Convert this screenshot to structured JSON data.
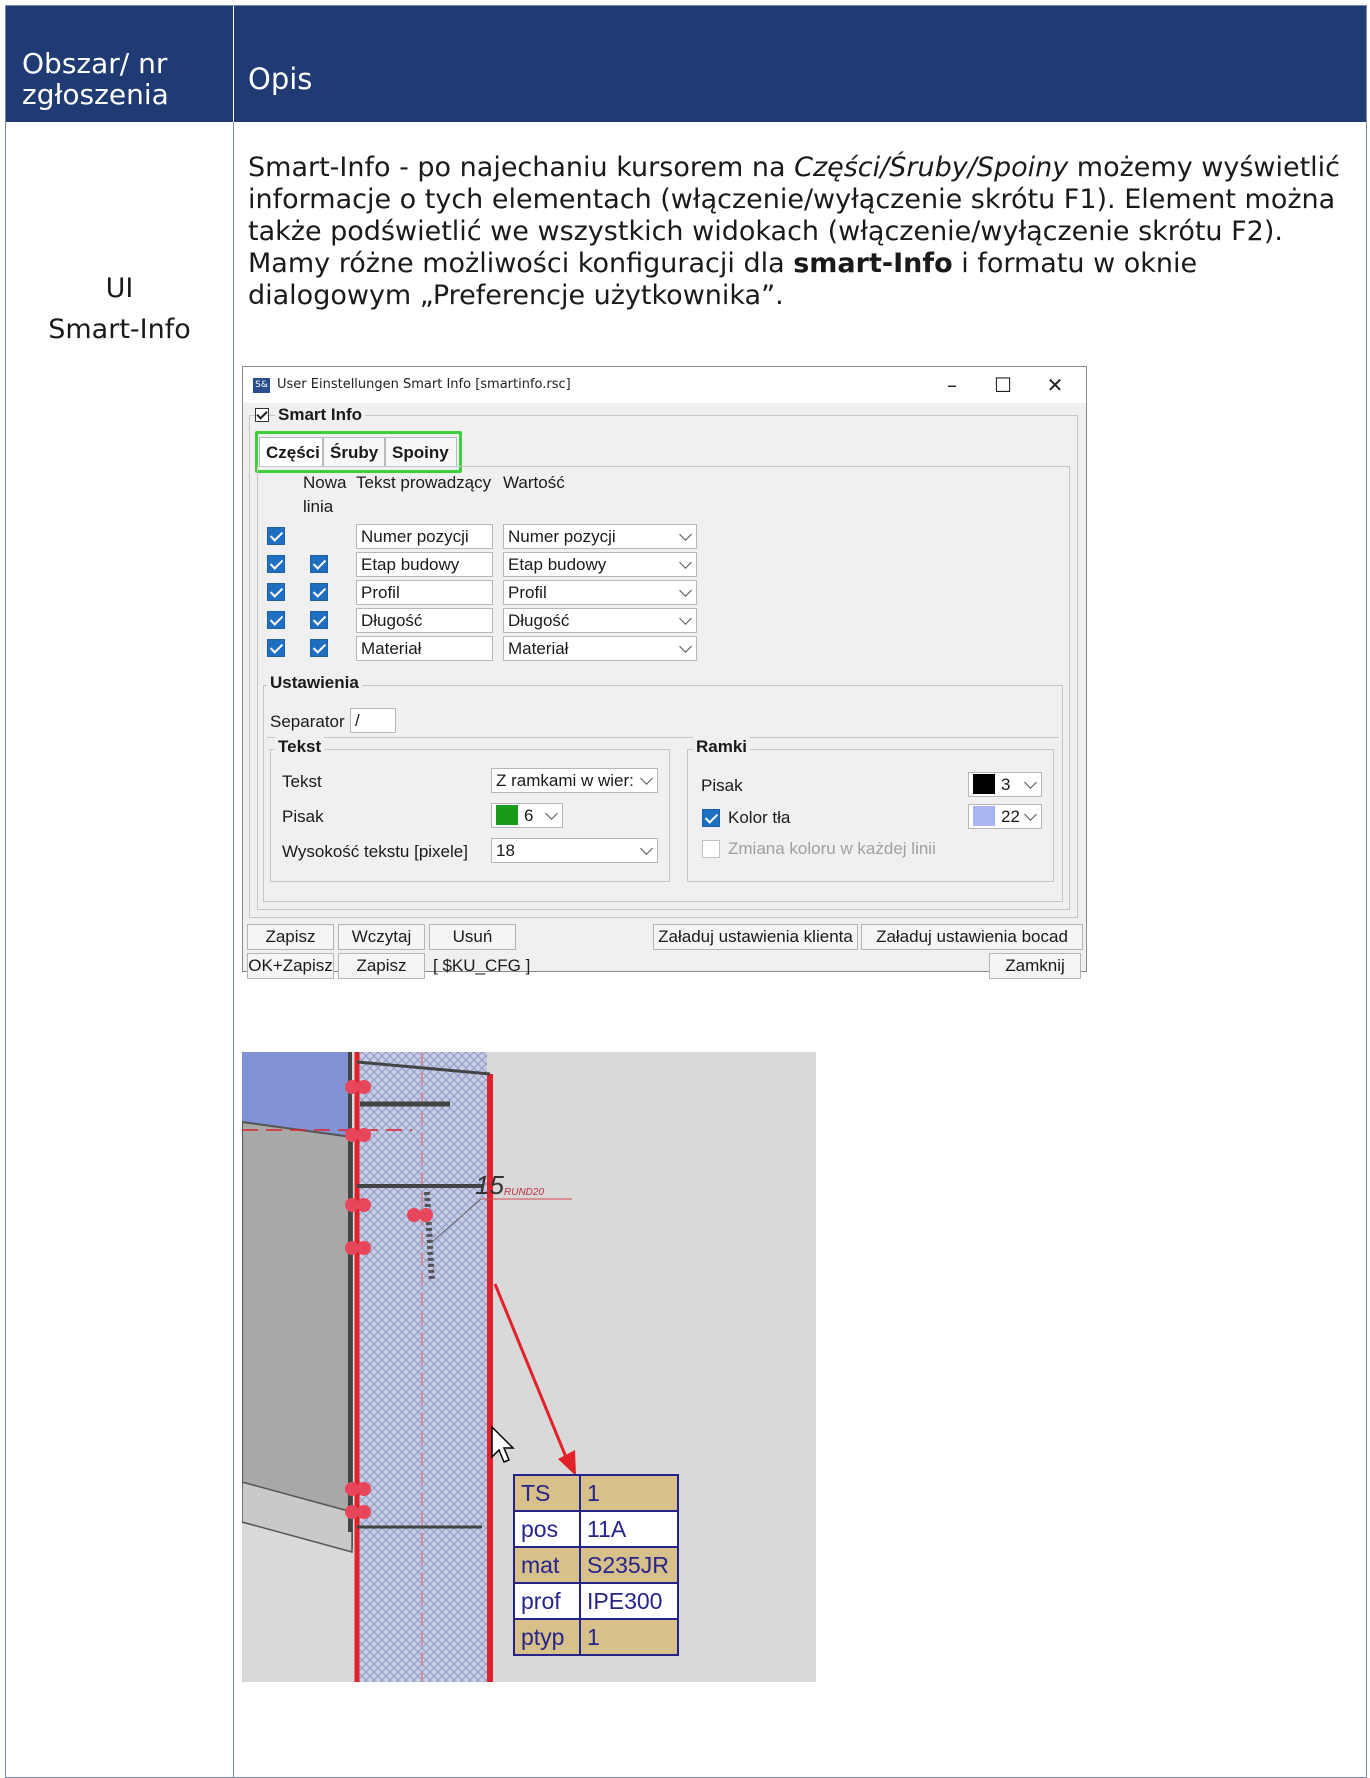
{
  "header": {
    "col_area": "Obszar/ nr zgłoszenia",
    "col_desc": "Opis"
  },
  "row": {
    "area_line1": "UI",
    "area_line2": "Smart-Info",
    "desc": {
      "p1_a": "Smart-Info - po najechaniu kursorem na ",
      "p1_em": "Części/Śruby/Spoiny",
      "p1_b": " możemy wyświetlić informacje o tych elementach (włączenie/wyłączenie skrótu F1). Element można także podświetlić we wszystkich widokach (włączenie/wyłączenie skrótu F2). Mamy różne możliwości konfiguracji dla ",
      "p1_strong": "smart-Info",
      "p1_c": " i formatu w oknie dialogowym „Preferencje użytkownika”."
    }
  },
  "dialog": {
    "app_icon": "S&",
    "title": "User Einstellungen Smart Info [smartinfo.rsc]",
    "win_min": "–",
    "win_max": "☐",
    "win_close": "✕",
    "group_smart_info": "Smart Info",
    "tabs": [
      "Części",
      "Śruby",
      "Spoiny"
    ],
    "columns": {
      "new_line_1": "Nowa",
      "new_line_2": "linia",
      "lead_text": "Tekst prowadzący",
      "value": "Wartość"
    },
    "rows": [
      {
        "enabled": true,
        "new_line": false,
        "lead": "Numer pozycji",
        "value": "Numer pozycji"
      },
      {
        "enabled": true,
        "new_line": true,
        "lead": "Etap budowy",
        "value": "Etap budowy"
      },
      {
        "enabled": true,
        "new_line": true,
        "lead": "Profil",
        "value": "Profil"
      },
      {
        "enabled": true,
        "new_line": true,
        "lead": "Długość",
        "value": "Długość"
      },
      {
        "enabled": true,
        "new_line": true,
        "lead": "Materiał",
        "value": "Materiał"
      }
    ],
    "settings": {
      "label": "Ustawienia",
      "separator_label": "Separator",
      "separator_value": "/",
      "text_group": {
        "label": "Tekst",
        "text_label": "Tekst",
        "text_value": "Z ramkami w wier:",
        "pen_label": "Pisak",
        "pen_value": "6",
        "pen_color": "#1a9a1a",
        "height_label": "Wysokość tekstu [pixele]",
        "height_value": "18"
      },
      "frames_group": {
        "label": "Ramki",
        "pen_label": "Pisak",
        "pen_value": "3",
        "pen_color": "#000000",
        "bg_label": "Kolor tła",
        "bg_value": "22",
        "bg_color": "#a9b6f2",
        "change_label": "Zmiana koloru w każdej linii"
      }
    },
    "buttons": {
      "save": "Zapisz",
      "load": "Wczytaj",
      "delete": "Usuń",
      "load_client": "Załaduj ustawienia klienta",
      "load_bocad": "Załaduj ustawienia bocad",
      "ok_save": "OK+Zapisz",
      "save2": "Zapisz",
      "cfg": "[ $KU_CFG ]",
      "close": "Zamknij"
    }
  },
  "cad": {
    "weld_size": "15",
    "weld_note": "RUND20",
    "info": [
      {
        "key": "TS",
        "value": "1"
      },
      {
        "key": "pos",
        "value": "11A"
      },
      {
        "key": "mat",
        "value": "S235JR"
      },
      {
        "key": "prof",
        "value": "IPE300"
      },
      {
        "key": "ptyp",
        "value": "1"
      }
    ]
  }
}
